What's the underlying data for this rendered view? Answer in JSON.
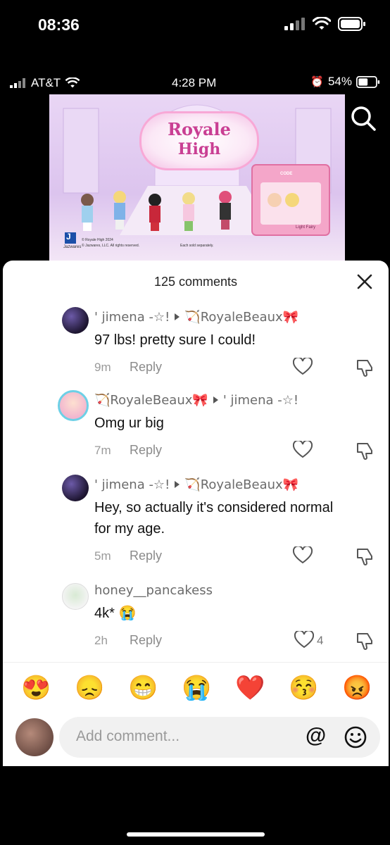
{
  "outer_status": {
    "time": "08:36"
  },
  "inner_status": {
    "carrier": "AT&T",
    "time": "4:28 PM",
    "battery": "54%"
  },
  "banner": {
    "logo_line1": "Royale",
    "logo_line2": "High",
    "publisher_mark": "J",
    "publisher_name": "Jazwares",
    "copyright_line1": "© Royale High 2024",
    "copyright_line2": "© Jazwares, LLC. All rights reserved.",
    "sold_separately": "Each sold separately.",
    "box_label": "Light Fairy",
    "box_code": "CODE"
  },
  "comments_header": {
    "title": "125 comments"
  },
  "comments": [
    {
      "author": "' jimena -☆!",
      "reply_to": "🏹RoyaleBeaux🎀",
      "text": "97 lbs! pretty sure I could!",
      "time": "9m",
      "reply_label": "Reply",
      "likes": ""
    },
    {
      "author": "🏹RoyaleBeaux🎀",
      "reply_to": "' jimena -☆!",
      "text": "Omg ur big",
      "time": "7m",
      "reply_label": "Reply",
      "likes": ""
    },
    {
      "author": "' jimena -☆!",
      "reply_to": "🏹RoyaleBeaux🎀",
      "text_line1": "Hey, so actually it's considered normal",
      "text_line2": "for my age.",
      "time": "5m",
      "reply_label": "Reply",
      "likes": ""
    },
    {
      "author": "honey__pancakess",
      "reply_to": "",
      "text": "4k* 😭",
      "time": "2h",
      "reply_label": "Reply",
      "likes": "4"
    }
  ],
  "emoji_bar": [
    "😍",
    "😞",
    "😁",
    "😭",
    "❤️",
    "😚",
    "😡"
  ],
  "comment_input": {
    "placeholder": "Add comment...",
    "mention_symbol": "@"
  },
  "colors": {
    "sheet_bg": "#ffffff",
    "text_primary": "#111111",
    "text_secondary": "#8a8a8a",
    "input_bg": "#f1f1f1"
  }
}
